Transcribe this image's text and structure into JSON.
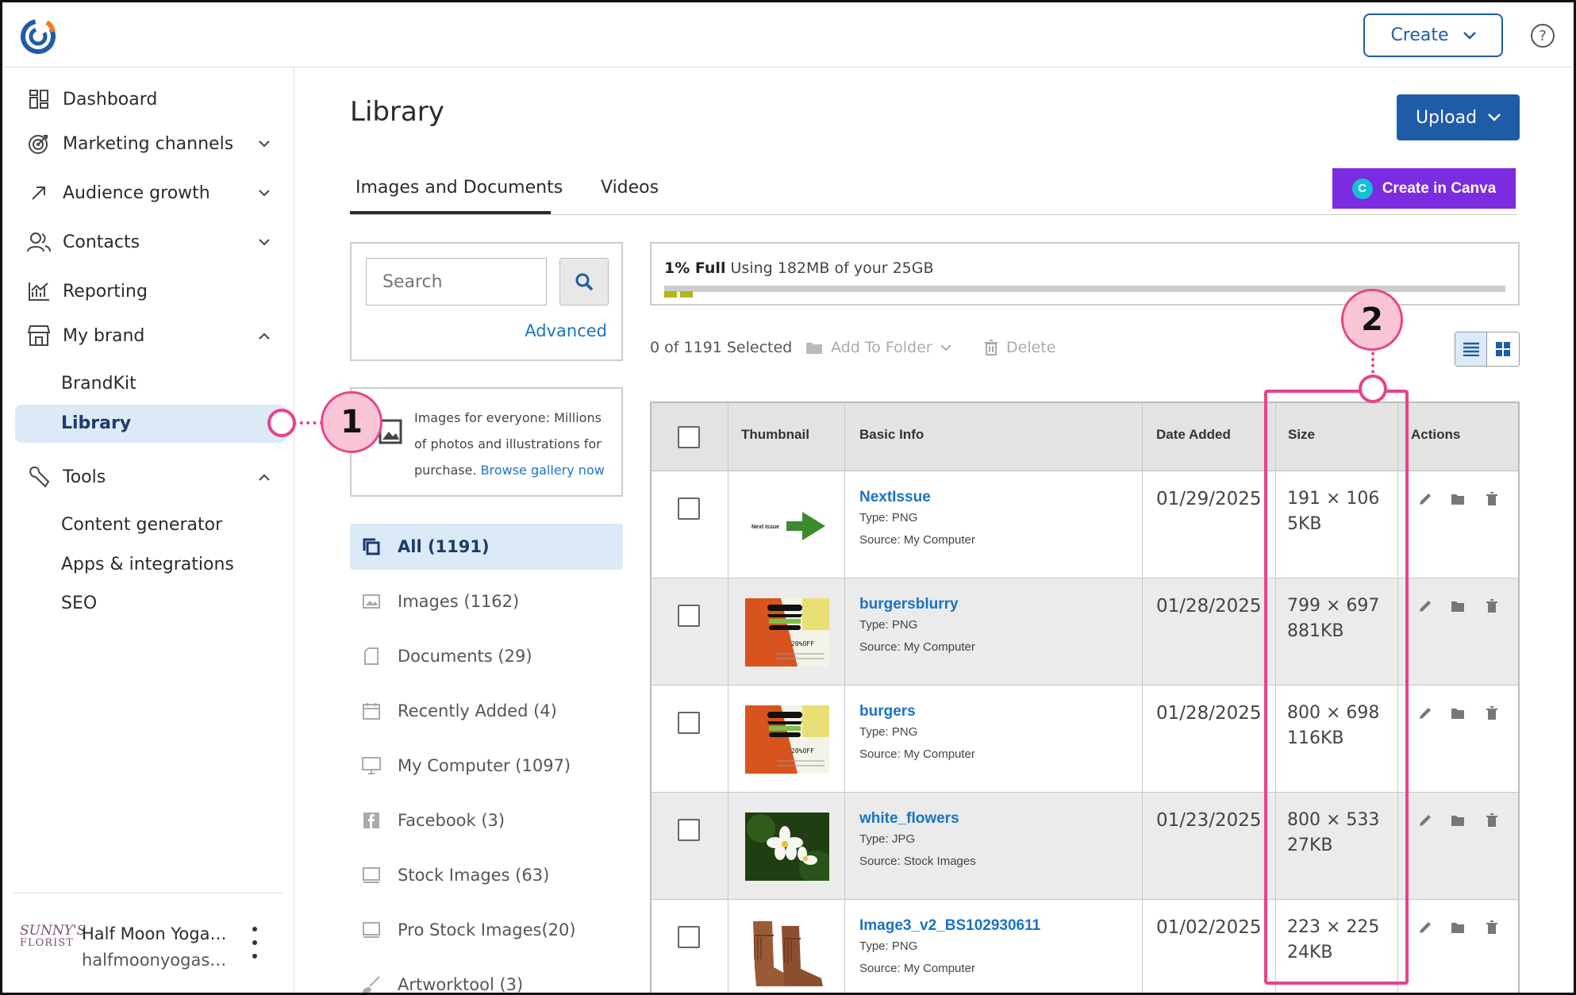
{
  "header": {
    "logo_icon": "constant-contact-logo",
    "create_label": "Create",
    "help_icon": "help-icon",
    "help_glyph": "?"
  },
  "sidebar": {
    "items": [
      {
        "label": "Dashboard",
        "icon": "dashboard-icon"
      },
      {
        "label": "Marketing channels",
        "icon": "target-icon"
      },
      {
        "label": "Audience growth",
        "icon": "arrow-up-right-icon"
      },
      {
        "label": "Contacts",
        "icon": "people-icon"
      },
      {
        "label": "Reporting",
        "icon": "chart-icon"
      },
      {
        "label": "My brand",
        "icon": "storefront-icon"
      },
      {
        "label": "Tools",
        "icon": "wrench-icon"
      }
    ],
    "my_brand_sub": [
      "BrandKit",
      "Library"
    ],
    "tools_sub": [
      "Content generator",
      "Apps & integrations",
      "SEO"
    ],
    "account": {
      "logo_text_1": "SUNNY'S",
      "logo_text_2": "FLORIST",
      "name": "Half Moon Yoga…",
      "email": "halfmoonyogas…"
    }
  },
  "main": {
    "title": "Library",
    "upload_label": "Upload",
    "canva_label": "Create in Canva",
    "canva_glyph": "C",
    "tabs": [
      {
        "label": "Images and Documents",
        "active": true
      },
      {
        "label": "Videos",
        "active": false
      }
    ],
    "search": {
      "placeholder": "Search",
      "advanced_label": "Advanced"
    },
    "gallery": {
      "text": "Images for everyone: Millions of photos and illustrations for purchase.",
      "link": "Browse gallery now"
    },
    "folders": [
      {
        "label": "All (1191)",
        "icon": "all-items-icon",
        "active": true
      },
      {
        "label": "Images (1162)",
        "icon": "image-icon"
      },
      {
        "label": "Documents (29)",
        "icon": "document-icon"
      },
      {
        "label": "Recently Added (4)",
        "icon": "calendar-icon"
      },
      {
        "label": "My Computer (1097)",
        "icon": "monitor-icon"
      },
      {
        "label": "Facebook (3)",
        "icon": "facebook-icon"
      },
      {
        "label": "Stock Images (63)",
        "icon": "stock-image-icon"
      },
      {
        "label": "Pro Stock Images(20)",
        "icon": "pro-stock-icon"
      },
      {
        "label": "Artworktool (3)",
        "icon": "brush-icon"
      }
    ],
    "storage": {
      "percent_label": "1% Full",
      "usage_text": "Using 182MB of your 25GB",
      "fill_fraction": 0.01,
      "fill_color": "#b1b51a"
    },
    "toolbar": {
      "selected": "0 of 1191 Selected",
      "add_to_folder": "Add To Folder",
      "delete": "Delete"
    },
    "table": {
      "headers": [
        "Thumbnail",
        "Basic Info",
        "Date Added",
        "Size",
        "Actions"
      ],
      "rows": [
        {
          "name": "NextIssue",
          "type": "Type: PNG",
          "source": "Source: My Computer",
          "date": "01/29/2025",
          "dims": "191 × 106",
          "size": "5KB",
          "thumb": "next-issue",
          "thumb_text": "Next Issue"
        },
        {
          "name": "burgersblurry",
          "type": "Type: PNG",
          "source": "Source: My Computer",
          "date": "01/28/2025",
          "dims": "799 × 697",
          "size": "881KB",
          "thumb": "burger",
          "thumb_text": "20%OFF"
        },
        {
          "name": "burgers",
          "type": "Type: PNG",
          "source": "Source: My Computer",
          "date": "01/28/2025",
          "dims": "800 × 698",
          "size": "116KB",
          "thumb": "burger",
          "thumb_text": "20%OFF"
        },
        {
          "name": "white_flowers",
          "type": "Type: JPG",
          "source": "Source: Stock Images",
          "date": "01/23/2025",
          "dims": "800 × 533",
          "size": "27KB",
          "thumb": "flowers",
          "thumb_text": ""
        },
        {
          "name": "Image3_v2_BS102930611",
          "type": "Type: PNG",
          "source": "Source: My Computer",
          "date": "01/02/2025",
          "dims": "223 × 225",
          "size": "24KB",
          "thumb": "boots",
          "thumb_text": ""
        }
      ]
    }
  },
  "callouts": [
    {
      "label": "1",
      "target": "library"
    },
    {
      "label": "2",
      "target": "size-column"
    }
  ],
  "colors": {
    "primary": "#1f5ca8",
    "link": "#1a73c4",
    "canva": "#7b2be0",
    "callout": "#e8438a",
    "active_bg": "#dce9f6"
  }
}
